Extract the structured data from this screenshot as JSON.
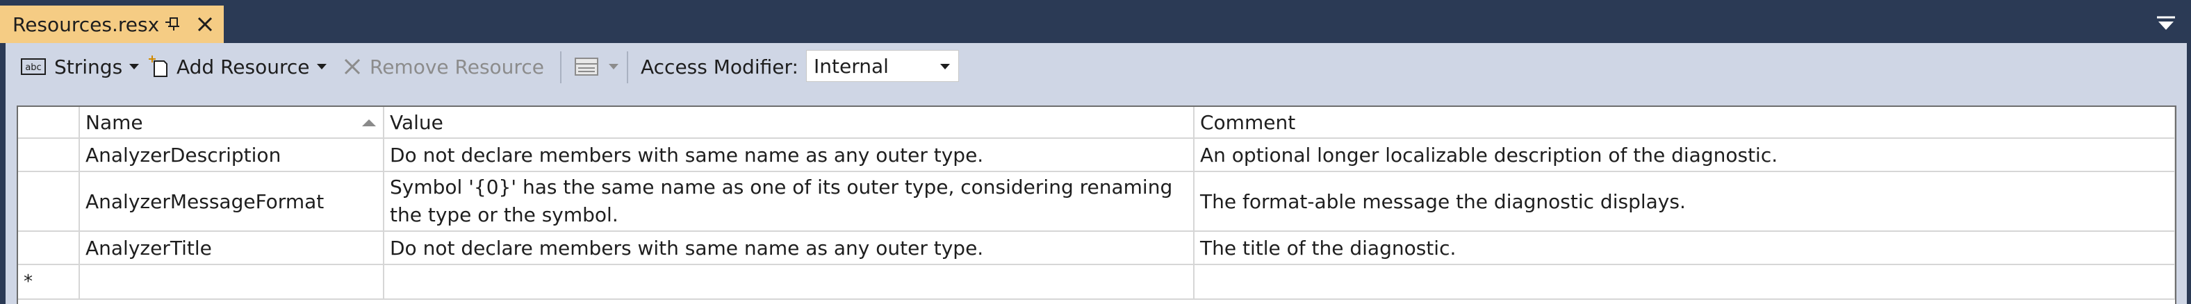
{
  "tab": {
    "title": "Resources.resx",
    "pin_icon": "pin-icon",
    "close_icon": "close-icon"
  },
  "toolbar": {
    "strings_label": "Strings",
    "add_resource_label": "Add Resource",
    "remove_resource_label": "Remove Resource",
    "access_modifier_label": "Access Modifier:",
    "access_modifier_value": "Internal"
  },
  "grid": {
    "columns": [
      "Name",
      "Value",
      "Comment"
    ],
    "sort_column": "Name",
    "rows": [
      {
        "name": "AnalyzerDescription",
        "value": "Do not declare members with same name as any outer type.",
        "comment": "An optional longer localizable description of the diagnostic."
      },
      {
        "name": "AnalyzerMessageFormat",
        "value": "Symbol '{0}' has the same name as one of its outer type, considering renaming the type or the symbol.",
        "comment": "The format-able message the diagnostic displays."
      },
      {
        "name": "AnalyzerTitle",
        "value": "Do not declare members with same name as any outer type.",
        "comment": "The title of the diagnostic."
      }
    ],
    "new_row_marker": "*"
  },
  "colors": {
    "tab_background": "#f5cc84",
    "window_background": "#2b3a55",
    "toolbar_background": "#cfd6e5",
    "disabled_text": "#8c8c8c"
  }
}
